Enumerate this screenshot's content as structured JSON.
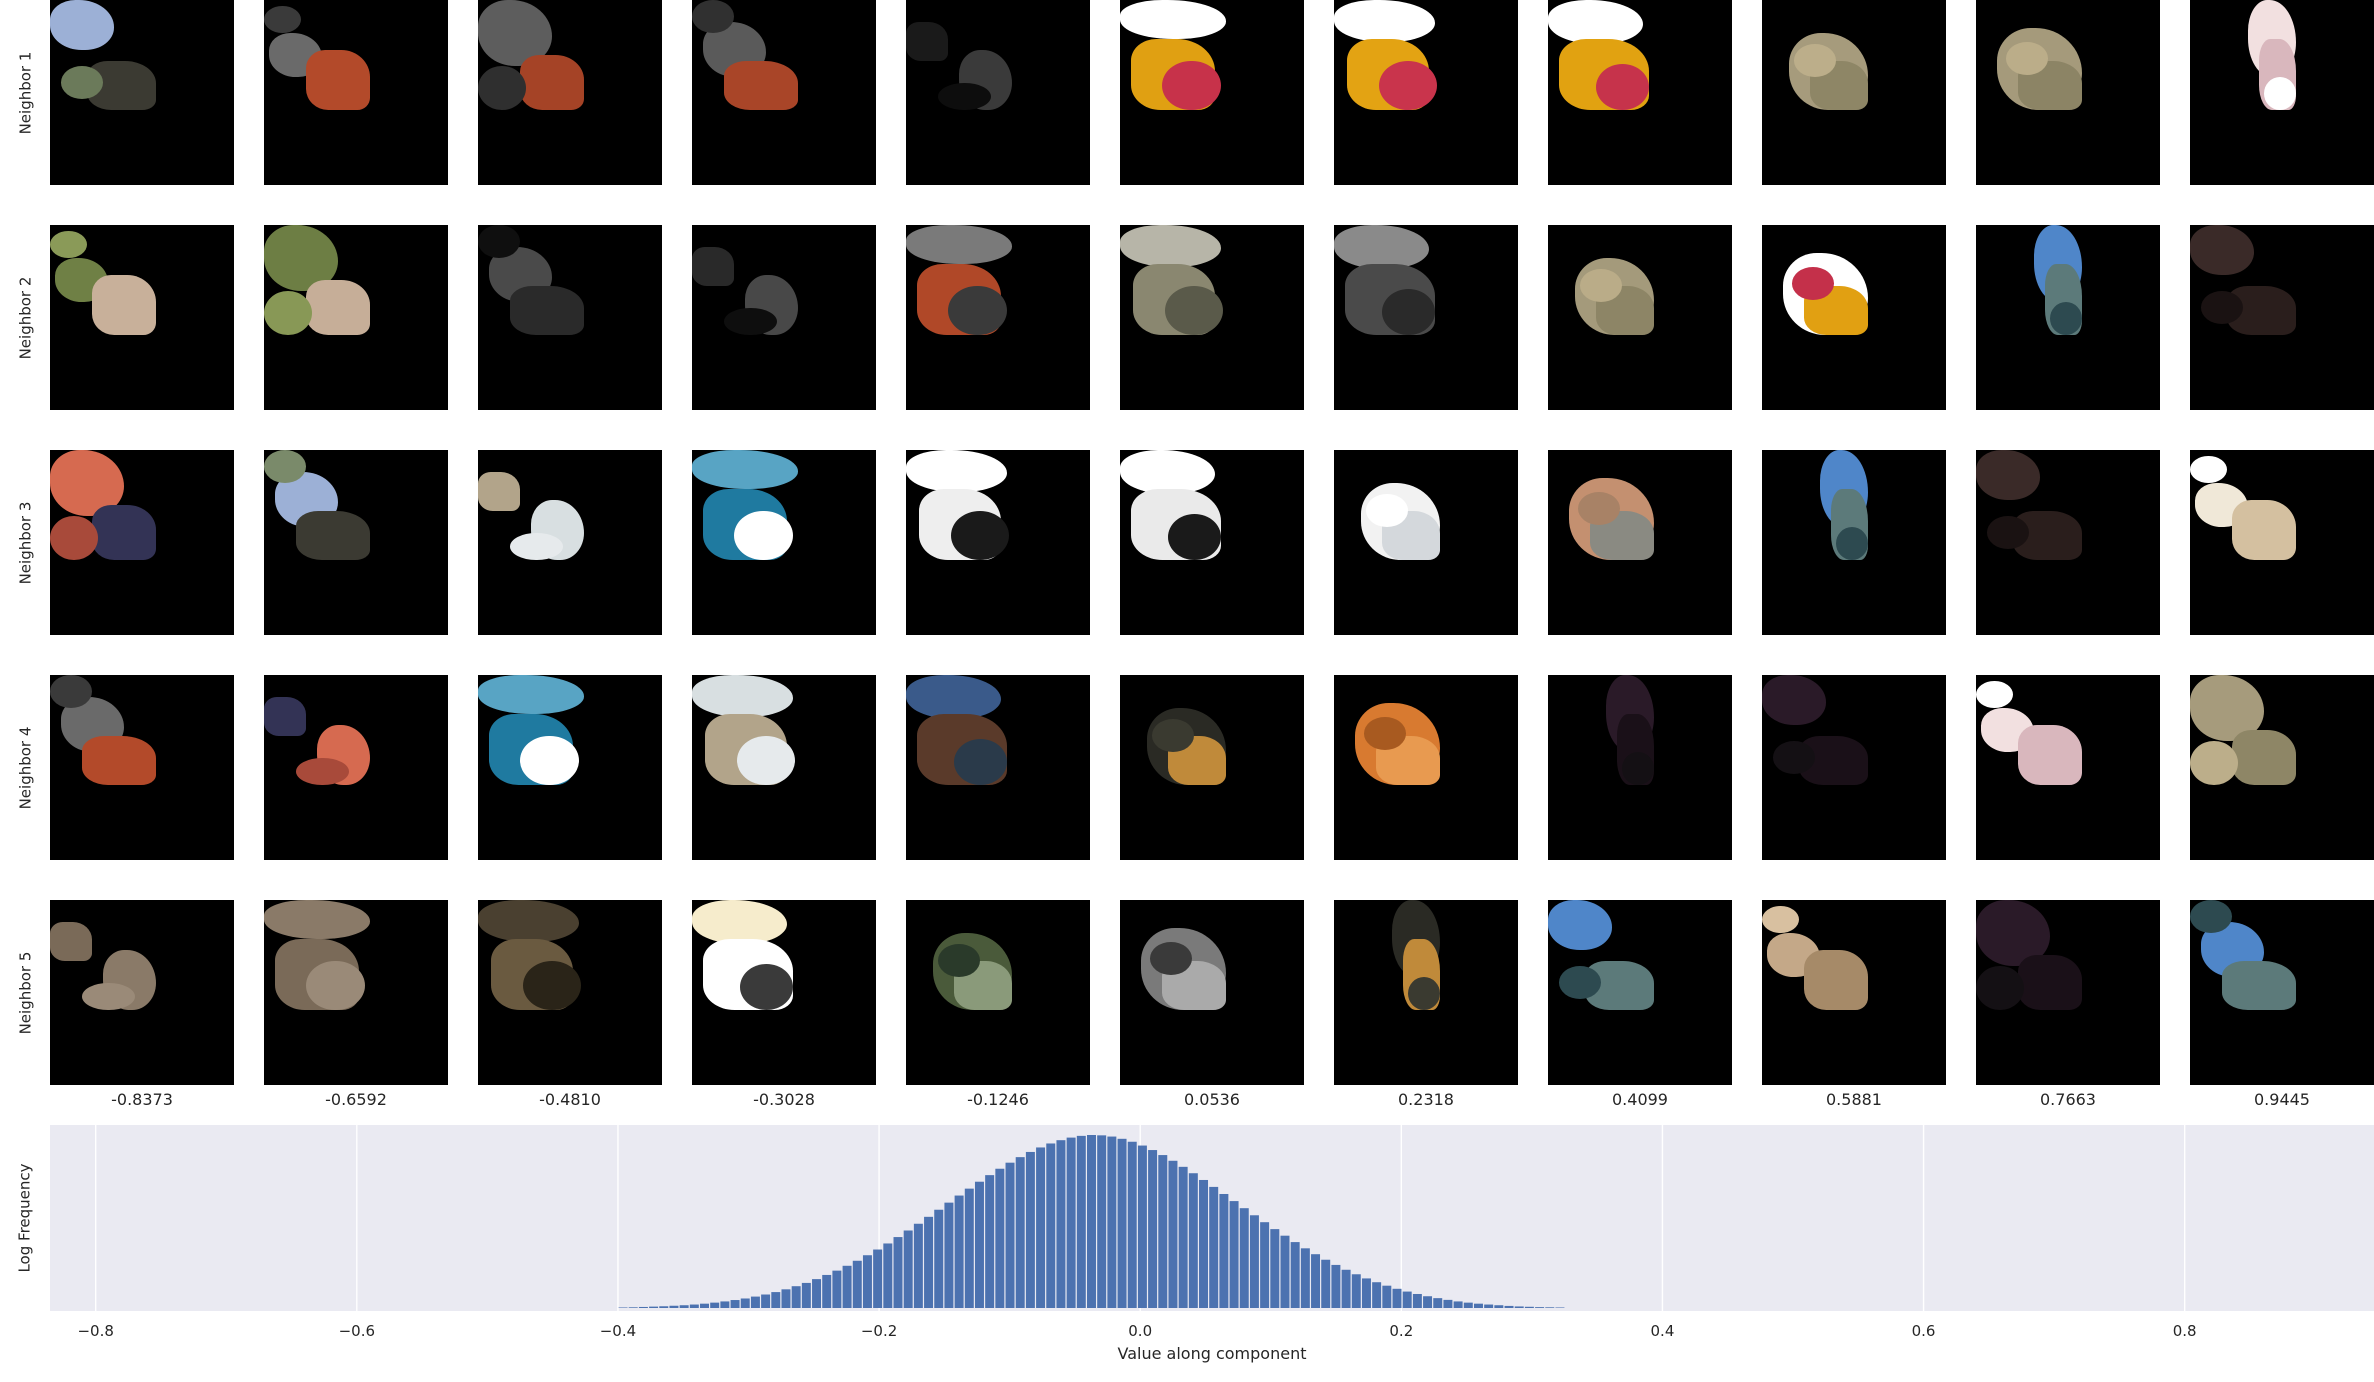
{
  "rows": [
    {
      "label": "Neighbor 1",
      "tiles": [
        [
          "#9cb0d6",
          "#3b3a32",
          "#6b7a5a"
        ],
        [
          "#6a6a6a",
          "#b34a2a",
          "#3a3a3a"
        ],
        [
          "#5d5d5d",
          "#a54326",
          "#2f2f2f"
        ],
        [
          "#5a5a5a",
          "#a94528",
          "#303030"
        ],
        [
          "#3a3a3a",
          "#1a1a1a",
          "#0d0d0d"
        ],
        [
          "#ffffff",
          "#e0a012",
          "#c7324a"
        ],
        [
          "#ffffff",
          "#e3a313",
          "#c9344c"
        ],
        [
          "#ffffff",
          "#e1a211",
          "#c6334b"
        ],
        [
          "#a69b7c",
          "#8e8666",
          "#bcae8a"
        ],
        [
          "#a59a7b",
          "#8c8465",
          "#bbad89"
        ],
        [
          "#f2e0e0",
          "#d9b7bd",
          "#ffffff"
        ]
      ]
    },
    {
      "label": "Neighbor 2",
      "tiles": [
        [
          "#6f8045",
          "#c8b09a",
          "#8a9a58"
        ],
        [
          "#6d7e44",
          "#c6ae98",
          "#889856"
        ],
        [
          "#4a4a4a",
          "#2a2a2a",
          "#0f0f0f"
        ],
        [
          "#484848",
          "#292929",
          "#0e0e0e"
        ],
        [
          "#7a7a7a",
          "#b04828",
          "#3a3a3a"
        ],
        [
          "#b7b5a8",
          "#8a8770",
          "#5a5a4a"
        ],
        [
          "#8a8a8a",
          "#4a4a4a",
          "#2a2a2a"
        ],
        [
          "#a49a7b",
          "#8d8566",
          "#baac88"
        ],
        [
          "#ffffff",
          "#e1a012",
          "#c4304a"
        ],
        [
          "#4f86c9",
          "#5c7a7a",
          "#2d4a50"
        ],
        [
          "#3a2a28",
          "#2a1e1c",
          "#1a1212"
        ]
      ]
    },
    {
      "label": "Neighbor 3",
      "tiles": [
        [
          "#d66a50",
          "#333355",
          "#a84a3a"
        ],
        [
          "#9cb0d6",
          "#3b3a32",
          "#7a8a6a"
        ],
        [
          "#d8dfe1",
          "#b2a48a",
          "#e6eaec"
        ],
        [
          "#58a4c4",
          "#1f7aa0",
          "#ffffff"
        ],
        [
          "#ffffff",
          "#eeeeee",
          "#1a1a1a"
        ],
        [
          "#ffffff",
          "#eaeaea",
          "#1a1a1a"
        ],
        [
          "#f2f2f2",
          "#d4d8dc",
          "#ffffff"
        ],
        [
          "#c49070",
          "#8a8a82",
          "#a88266"
        ],
        [
          "#4f86c9",
          "#5c7a7a",
          "#2d4a50"
        ],
        [
          "#3a2a28",
          "#2a1e1c",
          "#1a1212"
        ],
        [
          "#f0e8d8",
          "#d4c0a0",
          "#ffffff"
        ]
      ]
    },
    {
      "label": "Neighbor 4",
      "tiles": [
        [
          "#6a6a6a",
          "#b34a2a",
          "#3a3a3a"
        ],
        [
          "#d66a50",
          "#333355",
          "#a84a3a"
        ],
        [
          "#58a4c4",
          "#1f7aa0",
          "#ffffff"
        ],
        [
          "#d8dfe1",
          "#b2a48a",
          "#e6eaec"
        ],
        [
          "#3a5a8a",
          "#5a3a2a",
          "#2a3a4a"
        ],
        [
          "#2a2a24",
          "#c08a3a",
          "#3a3a30"
        ],
        [
          "#d87a30",
          "#e89a50",
          "#a85a20"
        ],
        [
          "#2a1a28",
          "#1a1018",
          "#141014"
        ],
        [
          "#2a1a28",
          "#1a1018",
          "#141014"
        ],
        [
          "#f2e0e0",
          "#d9b7bd",
          "#ffffff"
        ],
        [
          "#a69b7c",
          "#8e8666",
          "#bcae8a"
        ]
      ]
    },
    {
      "label": "Neighbor 5",
      "tiles": [
        [
          "#8a7a68",
          "#7a6a58",
          "#9a8a78"
        ],
        [
          "#8a7a68",
          "#7a6a58",
          "#9a8a78"
        ],
        [
          "#4a4030",
          "#6a5a40",
          "#2a2418"
        ],
        [
          "#f6eccc",
          "#ffffff",
          "#3a3a3a"
        ],
        [
          "#4a5a3a",
          "#8a9a7a",
          "#2a3a2a"
        ],
        [
          "#7a7a7a",
          "#aaaaaa",
          "#3a3a3a"
        ],
        [
          "#2a2a24",
          "#c08a3a",
          "#3a3a30"
        ],
        [
          "#4f86c9",
          "#5c7a7a",
          "#2d4a50"
        ],
        [
          "#c4a888",
          "#a68a68",
          "#d8c0a0"
        ],
        [
          "#2a1a28",
          "#1a1018",
          "#141014"
        ],
        [
          "#4f86c9",
          "#5c7a7a",
          "#2d4a50"
        ]
      ]
    }
  ],
  "column_values": [
    "-0.8373",
    "-0.6592",
    "-0.4810",
    "-0.3028",
    "-0.1246",
    "0.0536",
    "0.2318",
    "0.4099",
    "0.5881",
    "0.7663",
    "0.9445"
  ],
  "chart_data": {
    "type": "bar",
    "title": "",
    "xlabel": "Value along component",
    "ylabel": "Log Frequency",
    "xlim": [
      -0.835,
      0.945
    ],
    "xticks": [
      -0.8,
      -0.6,
      -0.4,
      -0.2,
      0.0,
      0.2,
      0.4,
      0.6,
      0.8
    ],
    "xtick_labels": [
      "−0.8",
      "−0.6",
      "−0.4",
      "−0.2",
      "0.0",
      "0.2",
      "0.4",
      "0.6",
      "0.8"
    ],
    "bar_color": "#4c72b0",
    "background": "#eaeaf2",
    "grid": true,
    "bins": {
      "start": -0.4,
      "width": 0.0078,
      "heights": [
        0.003,
        0.004,
        0.006,
        0.008,
        0.01,
        0.013,
        0.016,
        0.02,
        0.025,
        0.031,
        0.038,
        0.046,
        0.055,
        0.066,
        0.078,
        0.092,
        0.108,
        0.126,
        0.145,
        0.167,
        0.191,
        0.216,
        0.244,
        0.273,
        0.305,
        0.338,
        0.373,
        0.41,
        0.448,
        0.487,
        0.527,
        0.568,
        0.609,
        0.65,
        0.69,
        0.73,
        0.768,
        0.805,
        0.84,
        0.872,
        0.902,
        0.928,
        0.951,
        0.97,
        0.985,
        0.995,
        1.0,
        0.998,
        0.991,
        0.978,
        0.961,
        0.939,
        0.913,
        0.884,
        0.851,
        0.816,
        0.779,
        0.74,
        0.7,
        0.659,
        0.618,
        0.577,
        0.536,
        0.496,
        0.456,
        0.418,
        0.381,
        0.345,
        0.311,
        0.279,
        0.249,
        0.221,
        0.195,
        0.171,
        0.149,
        0.129,
        0.111,
        0.095,
        0.081,
        0.068,
        0.057,
        0.047,
        0.038,
        0.031,
        0.025,
        0.02,
        0.016,
        0.012,
        0.009,
        0.007,
        0.005,
        0.004,
        0.003
      ]
    }
  }
}
